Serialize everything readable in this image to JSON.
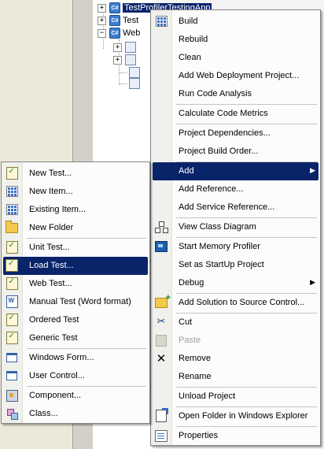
{
  "tree": {
    "items": [
      {
        "label": "TestProfilerTestingApp",
        "selected": true
      },
      {
        "label": "Test"
      },
      {
        "label": "Web"
      }
    ]
  },
  "context_menu": {
    "items": [
      {
        "label": "Build",
        "icon": "build-icon"
      },
      {
        "label": "Rebuild"
      },
      {
        "label": "Clean"
      },
      {
        "label": "Add Web Deployment Project..."
      },
      {
        "label": "Run Code Analysis"
      },
      {
        "label": "Calculate Code Metrics"
      },
      {
        "label": "Project Dependencies..."
      },
      {
        "label": "Project Build Order..."
      },
      {
        "label": "Add",
        "highlighted": true,
        "submenu": true
      },
      {
        "label": "Add Reference..."
      },
      {
        "label": "Add Service Reference..."
      },
      {
        "label": "View Class Diagram",
        "icon": "class-diagram-icon"
      },
      {
        "label": "Start Memory Profiler",
        "icon": "memory-profiler-icon"
      },
      {
        "label": "Set as StartUp Project"
      },
      {
        "label": "Debug",
        "submenu": true
      },
      {
        "label": "Add Solution to Source Control...",
        "icon": "add-source-control-icon"
      },
      {
        "label": "Cut",
        "icon": "scissors-icon"
      },
      {
        "label": "Paste",
        "icon": "paste-icon",
        "disabled": true
      },
      {
        "label": "Remove",
        "icon": "remove-x-icon"
      },
      {
        "label": "Rename"
      },
      {
        "label": "Unload Project"
      },
      {
        "label": "Open Folder in Windows Explorer",
        "icon": "open-folder-icon"
      },
      {
        "label": "Properties",
        "icon": "properties-icon"
      }
    ]
  },
  "add_submenu": {
    "items": [
      {
        "label": "New Test...",
        "icon": "new-test-icon"
      },
      {
        "label": "New Item...",
        "icon": "new-item-icon"
      },
      {
        "label": "Existing Item...",
        "icon": "existing-item-icon"
      },
      {
        "label": "New Folder",
        "icon": "folder-icon"
      },
      {
        "label": "Unit Test...",
        "icon": "unit-test-icon"
      },
      {
        "label": "Load Test...",
        "icon": "load-test-icon",
        "highlighted": true
      },
      {
        "label": "Web Test...",
        "icon": "web-test-icon"
      },
      {
        "label": "Manual Test (Word format)",
        "icon": "manual-test-word-icon"
      },
      {
        "label": "Ordered Test",
        "icon": "ordered-test-icon"
      },
      {
        "label": "Generic Test",
        "icon": "generic-test-icon"
      },
      {
        "label": "Windows Form...",
        "icon": "windows-form-icon"
      },
      {
        "label": "User Control...",
        "icon": "user-control-icon"
      },
      {
        "label": "Component...",
        "icon": "component-icon"
      },
      {
        "label": "Class...",
        "icon": "class-icon"
      }
    ]
  },
  "colors": {
    "highlight": "#0a246a",
    "menu_bg": "#fcfcfc",
    "gutter": "#f0f0ec"
  }
}
